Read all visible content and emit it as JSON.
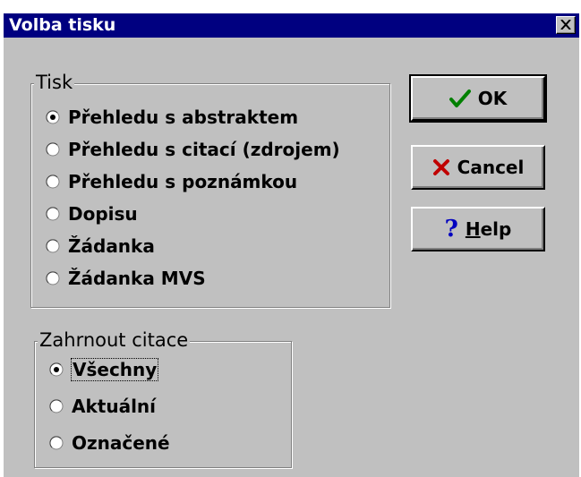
{
  "window": {
    "title": "Volba tisku"
  },
  "print_group": {
    "label": "Tisk",
    "options": [
      {
        "label": "Přehledu s abstraktem",
        "selected": true
      },
      {
        "label": "Přehledu s citací (zdrojem)",
        "selected": false
      },
      {
        "label": "Přehledu s poznámkou",
        "selected": false
      },
      {
        "label": "Dopisu",
        "selected": false
      },
      {
        "label": "Žádanka",
        "selected": false
      },
      {
        "label": "Žádanka MVS",
        "selected": false
      }
    ]
  },
  "citations_group": {
    "label": "Zahrnout citace",
    "options": [
      {
        "label": "Všechny",
        "selected": true
      },
      {
        "label": "Aktuální",
        "selected": false
      },
      {
        "label": "Označené",
        "selected": false
      }
    ]
  },
  "buttons": {
    "ok_label": "OK",
    "cancel_label": "Cancel",
    "help_label": "Help"
  },
  "colors": {
    "titlebar": "#000080",
    "face": "#c0c0c0",
    "ok_check": "#008000",
    "cancel_x": "#c00000",
    "help_q": "#0000c0"
  },
  "icons": {
    "close": "close-icon",
    "ok": "checkmark-icon",
    "cancel": "x-icon",
    "help": "question-mark-icon"
  }
}
